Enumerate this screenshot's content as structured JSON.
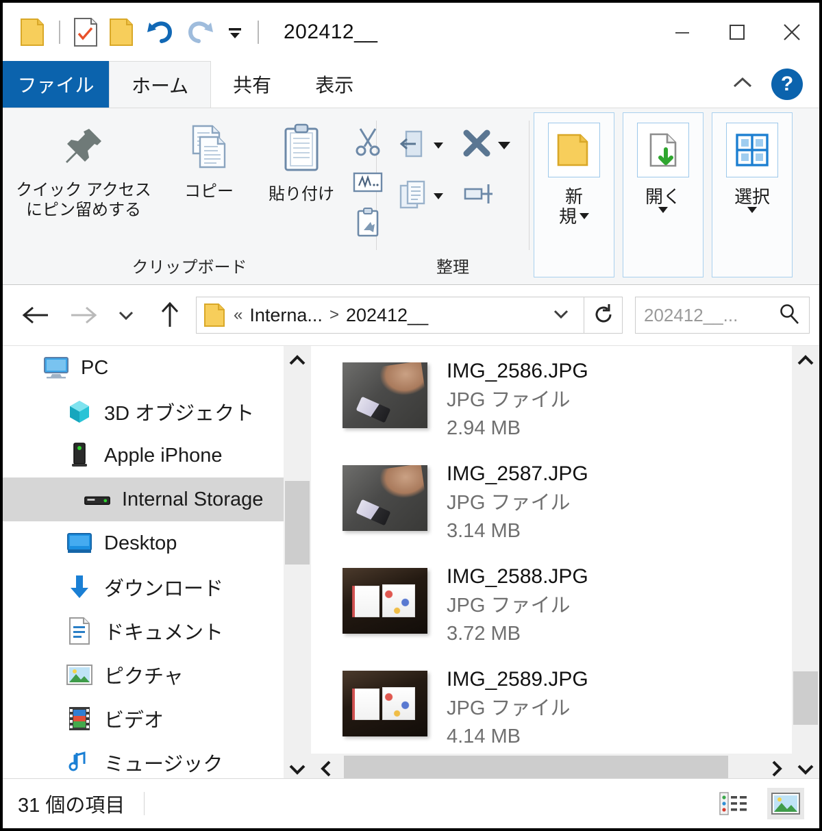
{
  "window": {
    "title": "202412__",
    "quick_access": [
      {
        "name": "folder-icon",
        "label": "folder"
      },
      {
        "name": "properties-icon",
        "label": "properties"
      },
      {
        "name": "new-folder-icon",
        "label": "new folder"
      },
      {
        "name": "undo-icon",
        "label": "undo"
      },
      {
        "name": "redo-icon",
        "label": "redo"
      },
      {
        "name": "customize-chevron-icon",
        "label": "customize"
      }
    ],
    "controls": {
      "minimize": "—",
      "maximize": "□",
      "close": "✕"
    }
  },
  "tabs": {
    "file": "ファイル",
    "items": [
      {
        "label": "ホーム",
        "active": true
      },
      {
        "label": "共有",
        "active": false
      },
      {
        "label": "表示",
        "active": false
      }
    ],
    "collapse_label": "^",
    "help_label": "?"
  },
  "ribbon": {
    "groups": [
      {
        "label": "クリップボード",
        "buttons": [
          {
            "label": "クイック アクセス\nにピン留めする",
            "line1": "クイック アクセス",
            "line2": "にピン留めする",
            "icon": "pin-icon"
          },
          {
            "label": "コピー",
            "icon": "copy-icon"
          },
          {
            "label": "貼り付け",
            "icon": "paste-icon"
          }
        ],
        "small_buttons": [
          {
            "name": "cut-icon"
          },
          {
            "name": "copy-path-icon"
          },
          {
            "name": "paste-shortcut-icon"
          }
        ]
      },
      {
        "label": "整理",
        "small_buttons": [
          {
            "name": "move-to-icon"
          },
          {
            "name": "delete-icon"
          },
          {
            "name": "copy-to-icon"
          },
          {
            "name": "rename-icon"
          }
        ]
      }
    ],
    "commands": [
      {
        "label": "新規",
        "line1": "新",
        "line2": "規",
        "icon": "new-folder-icon",
        "has_caret": true
      },
      {
        "label": "開く",
        "line1": "開く",
        "line2": "",
        "icon": "open-file-icon",
        "has_caret": true
      },
      {
        "label": "選択",
        "line1": "選択",
        "line2": "",
        "icon": "select-grid-icon",
        "has_caret": true
      }
    ]
  },
  "address": {
    "back": "←",
    "forward": "→",
    "recent_chevron": "⌄",
    "up": "↑",
    "folder_icon": "folder-icon",
    "crumb_overflow": "«",
    "crumbs": [
      "Interna...",
      "202412__"
    ],
    "crumb_separator": ">",
    "dropdown_chevron": "⌄",
    "refresh": "↻",
    "search_placeholder": "202412__..."
  },
  "nav_pane": {
    "items": [
      {
        "label": "PC",
        "icon": "pc-monitor-icon",
        "indent": 0,
        "selected": false
      },
      {
        "label": "3D オブジェクト",
        "icon": "3d-object-icon",
        "indent": 1,
        "selected": false
      },
      {
        "label": "Apple iPhone",
        "icon": "phone-device-icon",
        "indent": 1,
        "selected": false
      },
      {
        "label": "Internal Storage",
        "icon": "drive-icon",
        "indent": 2,
        "selected": true
      },
      {
        "label": "Desktop",
        "icon": "desktop-icon",
        "indent": 1,
        "selected": false
      },
      {
        "label": "ダウンロード",
        "icon": "downloads-icon",
        "indent": 1,
        "selected": false
      },
      {
        "label": "ドキュメント",
        "icon": "documents-icon",
        "indent": 1,
        "selected": false
      },
      {
        "label": "ピクチャ",
        "icon": "pictures-icon",
        "indent": 1,
        "selected": false
      },
      {
        "label": "ビデオ",
        "icon": "videos-icon",
        "indent": 1,
        "selected": false
      },
      {
        "label": "ミュージック",
        "icon": "music-icon",
        "indent": 1,
        "selected": false
      }
    ]
  },
  "files": {
    "items": [
      {
        "name": "IMG_2586.JPG",
        "type": "JPG ファイル",
        "size": "2.94 MB",
        "thumb": "hand"
      },
      {
        "name": "IMG_2587.JPG",
        "type": "JPG ファイル",
        "size": "3.14 MB",
        "thumb": "hand"
      },
      {
        "name": "IMG_2588.JPG",
        "type": "JPG ファイル",
        "size": "3.72 MB",
        "thumb": "docs"
      },
      {
        "name": "IMG_2589.JPG",
        "type": "JPG ファイル",
        "size": "4.14 MB",
        "thumb": "docs"
      }
    ]
  },
  "status": {
    "item_count": "31 個の項目",
    "views": [
      {
        "name": "details-view-button",
        "active": false
      },
      {
        "name": "large-icons-view-button",
        "active": true
      }
    ]
  },
  "colors": {
    "accent": "#0b63ad",
    "folder_yellow": "#f5c243",
    "selection_grey": "#d6d6d6",
    "ribbon_bg": "#f5f6f7"
  }
}
